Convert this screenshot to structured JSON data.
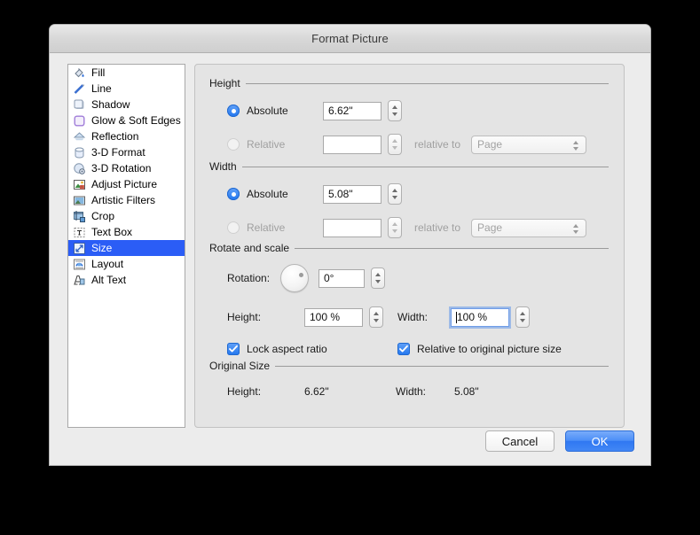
{
  "window": {
    "title": "Format Picture"
  },
  "sidebar": {
    "items": [
      {
        "label": "Fill",
        "icon": "paint-bucket-icon",
        "selected": false
      },
      {
        "label": "Line",
        "icon": "pencil-line-icon",
        "selected": false
      },
      {
        "label": "Shadow",
        "icon": "shadow-square-icon",
        "selected": false
      },
      {
        "label": "Glow & Soft Edges",
        "icon": "glow-square-icon",
        "selected": false
      },
      {
        "label": "Reflection",
        "icon": "reflection-icon",
        "selected": false
      },
      {
        "label": "3-D Format",
        "icon": "cylinder-icon",
        "selected": false
      },
      {
        "label": "3-D Rotation",
        "icon": "sphere-rotation-icon",
        "selected": false
      },
      {
        "label": "Adjust Picture",
        "icon": "picture-adjust-icon",
        "selected": false
      },
      {
        "label": "Artistic Filters",
        "icon": "filters-picture-icon",
        "selected": false
      },
      {
        "label": "Crop",
        "icon": "crop-icon",
        "selected": false
      },
      {
        "label": "Text Box",
        "icon": "text-box-icon",
        "selected": false
      },
      {
        "label": "Size",
        "icon": "resize-arrow-icon",
        "selected": true
      },
      {
        "label": "Layout",
        "icon": "layout-icon",
        "selected": false
      },
      {
        "label": "Alt Text",
        "icon": "alt-text-icon",
        "selected": false
      }
    ]
  },
  "height_group": {
    "title": "Height",
    "absolute_label": "Absolute",
    "absolute_value": "6.62\"",
    "absolute_selected": true,
    "relative_label": "Relative",
    "relative_value": "",
    "relative_to_label": "relative to",
    "relative_to_value": "Page"
  },
  "width_group": {
    "title": "Width",
    "absolute_label": "Absolute",
    "absolute_value": "5.08\"",
    "absolute_selected": true,
    "relative_label": "Relative",
    "relative_value": "",
    "relative_to_label": "relative to",
    "relative_to_value": "Page"
  },
  "rotate_scale_group": {
    "title": "Rotate and scale",
    "rotation_label": "Rotation:",
    "rotation_value": "0°",
    "scale_height_label": "Height:",
    "scale_height_value": "100 %",
    "scale_width_label": "Width:",
    "scale_width_value": "100 %",
    "lock_aspect_label": "Lock aspect ratio",
    "lock_aspect_checked": true,
    "relative_original_label": "Relative to original picture size",
    "relative_original_checked": true
  },
  "original_size_group": {
    "title": "Original Size",
    "height_label": "Height:",
    "height_value": "6.62\"",
    "width_label": "Width:",
    "width_value": "5.08\""
  },
  "buttons": {
    "cancel": "Cancel",
    "ok": "OK"
  },
  "colors": {
    "accent": "#2176ef",
    "selection": "#2b5df6",
    "window_bg": "#ececec",
    "panel_bg": "#e4e4e4"
  }
}
